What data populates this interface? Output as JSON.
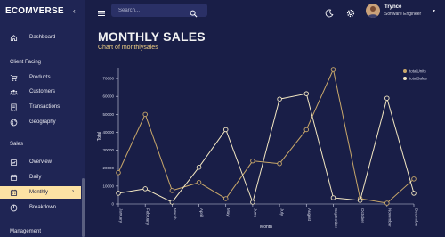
{
  "sidebar": {
    "brand": "ECOMVERSE",
    "items": [
      {
        "type": "item",
        "label": "Dashboard",
        "icon": "home-icon",
        "active": false
      },
      {
        "type": "section",
        "label": "Client Facing"
      },
      {
        "type": "item",
        "label": "Products",
        "icon": "cart-icon",
        "active": false
      },
      {
        "type": "item",
        "label": "Customers",
        "icon": "groups-icon",
        "active": false
      },
      {
        "type": "item",
        "label": "Transactions",
        "icon": "receipt-icon",
        "active": false
      },
      {
        "type": "item",
        "label": "Geography",
        "icon": "globe-icon",
        "active": false
      },
      {
        "type": "section",
        "label": "Sales"
      },
      {
        "type": "item",
        "label": "Overview",
        "icon": "overview-icon",
        "active": false
      },
      {
        "type": "item",
        "label": "Daily",
        "icon": "calendar-icon",
        "active": false
      },
      {
        "type": "item",
        "label": "Monthly",
        "icon": "calendar-month-icon",
        "active": true
      },
      {
        "type": "item",
        "label": "Breakdown",
        "icon": "pie-icon",
        "active": false
      },
      {
        "type": "section",
        "label": "Management"
      }
    ]
  },
  "topbar": {
    "search_placeholder": "Search...",
    "user_name": "Trynce",
    "user_role": "Software Engineer"
  },
  "header": {
    "title": "MONTHLY SALES",
    "subtitle": "Chart of monthlysales"
  },
  "colors": {
    "background": "#191e47",
    "sidebar": "#1f2554",
    "accent": "#fce2a4",
    "totalUnits": "#c9a86a",
    "totalSales": "#f3e7c2"
  },
  "chart_data": {
    "type": "line",
    "xlabel": "Month",
    "ylabel": "Total",
    "ylim": [
      0,
      75000
    ],
    "yticks": [
      0,
      10000,
      20000,
      30000,
      40000,
      50000,
      60000,
      70000
    ],
    "grid": false,
    "legend": "top-right",
    "categories": [
      "January",
      "February",
      "March",
      "April",
      "May",
      "June",
      "July",
      "August",
      "September",
      "October",
      "November",
      "December"
    ],
    "series": [
      {
        "name": "totalUnits",
        "values": [
          17500,
          50000,
          7500,
          12000,
          3000,
          24000,
          22500,
          41500,
          75000,
          3000,
          500,
          14000
        ]
      },
      {
        "name": "totalSales",
        "values": [
          6000,
          8500,
          1000,
          20500,
          41500,
          1000,
          58500,
          61500,
          3500,
          2000,
          59000,
          6000
        ]
      }
    ]
  }
}
